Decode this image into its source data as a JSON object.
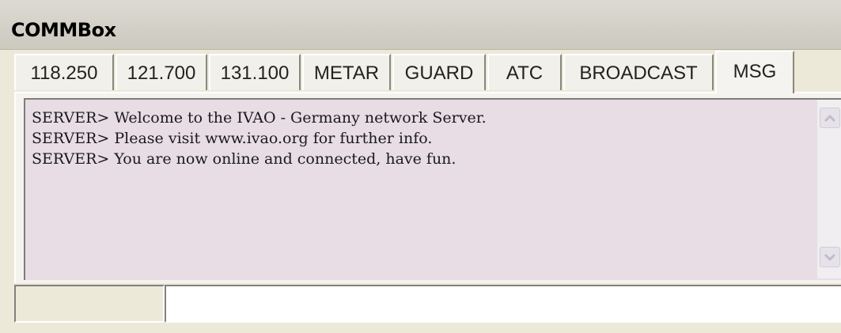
{
  "window": {
    "title": "COMMBox"
  },
  "tabs": [
    {
      "label": "118.250",
      "active": false
    },
    {
      "label": "121.700",
      "active": false
    },
    {
      "label": "131.100",
      "active": false
    },
    {
      "label": "METAR",
      "active": false
    },
    {
      "label": "GUARD",
      "active": false
    },
    {
      "label": "ATC",
      "active": false
    },
    {
      "label": "BROADCAST",
      "active": false
    },
    {
      "label": "MSG",
      "active": true
    }
  ],
  "messages": [
    "SERVER> Welcome to the IVAO - Germany network Server.",
    "SERVER> Please visit www.ivao.org for further info.",
    "SERVER> You are now online and connected, have fun."
  ],
  "input": {
    "frequency": "",
    "value": ""
  },
  "colors": {
    "message_background": "#e8dde4",
    "window_background": "#ece9d8"
  }
}
